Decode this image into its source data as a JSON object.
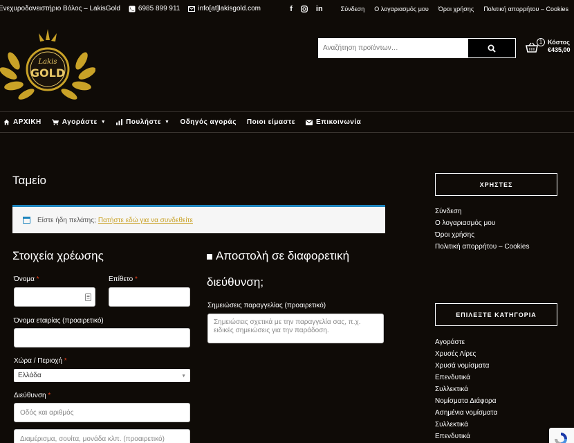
{
  "topbar": {
    "site_name": "Ενεχυροδανειστήριο Βόλος – LakisGold",
    "phone": "6985 899 911",
    "email": "info[at]lakisgold.com",
    "links": [
      "Σύνδεση",
      "Ο λογαριασμός μου",
      "Όροι χρήσης",
      "Πολιτική απορρήτου – Cookies"
    ]
  },
  "logo": {
    "line1": "Lakis",
    "line2": "GOLD"
  },
  "search": {
    "placeholder": "Αναζήτηση προϊόντων…"
  },
  "cart": {
    "count": "1",
    "label": "Κόστος",
    "amount": "€435,00"
  },
  "nav": {
    "items": [
      {
        "label": "ΑΡΧΙΚΗ"
      },
      {
        "label": "Αγοράστε"
      },
      {
        "label": "Πουλήστε"
      },
      {
        "label": "Οδηγός αγοράς"
      },
      {
        "label": "Ποιοι είμαστε"
      },
      {
        "label": "Επικοινωνία"
      }
    ]
  },
  "page": {
    "title": "Ταμείο",
    "notice_text": "Είστε ήδη πελάτης;",
    "notice_link": "Πατήστε εδώ για να συνδεθείτε"
  },
  "billing": {
    "heading": "Στοιχεία χρέωσης",
    "first_name_label": "Όνομα",
    "last_name_label": "Επίθετο",
    "required_mark": "*",
    "company_label": "Όνομα εταιρίας (προαιρετικό)",
    "country_label": "Χώρα / Περιοχή",
    "country_value": "Ελλάδα",
    "address_label": "Διεύθυνση",
    "address_placeholder": "Οδός και αριθμός",
    "address2_placeholder": "Διαμέρισμα, σουίτα, μονάδα κλπ. (προαιρετικό)"
  },
  "shipping": {
    "heading_line1": "Αποστολή σε διαφορετική",
    "heading_line2": "διεύθυνση;",
    "notes_label": "Σημειώσεις παραγγελίας (προαιρετικό)",
    "notes_placeholder": "Σημειώσεις σχετικά με την παραγγελία σας, π.χ. ειδικές σημειώσεις για την παράδοση."
  },
  "sidebar": {
    "users_title": "ΧΡΗΣΤΕΣ",
    "users_links": [
      "Σύνδεση",
      "Ο λογαριασμός μου",
      "Όροι χρήσης",
      "Πολιτική απορρήτου – Cookies"
    ],
    "category_title": "ΕΠΙΛΕΞΤΕ ΚΑΤΗΓΟΡΙΑ",
    "categories": [
      "Αγοράστε",
      "Χρυσές Λίρες",
      "Χρυσά νομίσματα",
      "Επενδυτικά",
      "Συλλεκτικά",
      "Νομίσματα Διάφορα",
      "Ασημένια νομίσματα",
      "Συλλεκτικά",
      "Επενδυτικά"
    ]
  },
  "colors": {
    "background": "#0f0b07",
    "gold": "#c9a227",
    "notice_border": "#1e85be",
    "required": "#e2401c"
  }
}
